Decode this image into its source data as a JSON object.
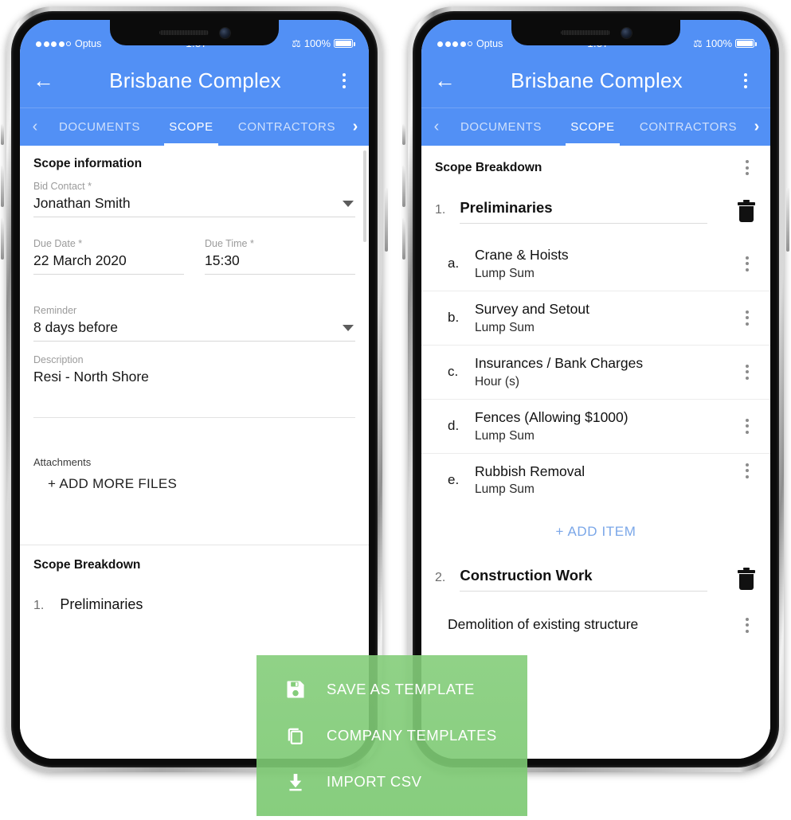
{
  "colors": {
    "header_blue": "#5290F5",
    "accent_link": "#7BA7E8",
    "menu_green": "#84CD7A",
    "text_dark": "#111111",
    "text_muted": "#9B9B9B"
  },
  "status_bar": {
    "carrier": "Optus",
    "signal_filled": 4,
    "signal_empty": 1,
    "time": "1:57",
    "bluetooth_icon": "bluetooth-icon",
    "battery_percent": "100%"
  },
  "appbar": {
    "back_icon": "back-arrow-icon",
    "title": "Brisbane Complex",
    "overflow_icon": "overflow-menu-icon"
  },
  "tabs": {
    "left_chevron": "‹",
    "right_chevron": "›",
    "items": [
      {
        "label": "DOCUMENTS",
        "active": false
      },
      {
        "label": "SCOPE",
        "active": true
      },
      {
        "label": "CONTRACTORS",
        "active": false
      }
    ]
  },
  "left_screen": {
    "section_title": "Scope information",
    "fields": {
      "bid_contact": {
        "label": "Bid Contact *",
        "value": "Jonathan Smith",
        "control": "dropdown"
      },
      "due_date": {
        "label": "Due Date *",
        "value": "22 March 2020"
      },
      "due_time": {
        "label": "Due Time *",
        "value": "15:30"
      },
      "reminder": {
        "label": "Reminder",
        "value": "8 days before",
        "control": "dropdown"
      },
      "description": {
        "label": "Description",
        "value": "Resi - North Shore"
      }
    },
    "attachments": {
      "label": "Attachments",
      "add_button": "+ ADD MORE FILES"
    },
    "breakdown": {
      "title": "Scope Breakdown",
      "first_item_number": "1.",
      "first_item_name": "Preliminaries"
    }
  },
  "right_screen": {
    "breakdown_title": "Scope Breakdown",
    "overflow_icon": "overflow-menu-icon",
    "group1": {
      "number": "1.",
      "name": "Preliminaries",
      "delete_icon": "trash-icon",
      "items": [
        {
          "letter": "a.",
          "name": "Crane &  Hoists",
          "unit": "Lump Sum"
        },
        {
          "letter": "b.",
          "name": "Survey and Setout",
          "unit": "Lump Sum"
        },
        {
          "letter": "c.",
          "name": "Insurances / Bank Charges",
          "unit": "Hour (s)"
        },
        {
          "letter": "d.",
          "name": "Fences (Allowing $1000)",
          "unit": "Lump Sum"
        },
        {
          "letter": "e.",
          "name": "Rubbish Removal",
          "unit": "Lump Sum"
        }
      ],
      "add_item_label": "+ ADD ITEM"
    },
    "group2": {
      "number": "2.",
      "name": "Construction Work",
      "delete_icon": "trash-icon",
      "items": [
        {
          "name": "Demolition of existing structure"
        }
      ]
    }
  },
  "green_menu": {
    "items": [
      {
        "label": "SAVE AS TEMPLATE",
        "icon": "save-icon"
      },
      {
        "label": "COMPANY TEMPLATES",
        "icon": "copy-icon"
      },
      {
        "label": "IMPORT CSV",
        "icon": "download-icon"
      }
    ]
  }
}
